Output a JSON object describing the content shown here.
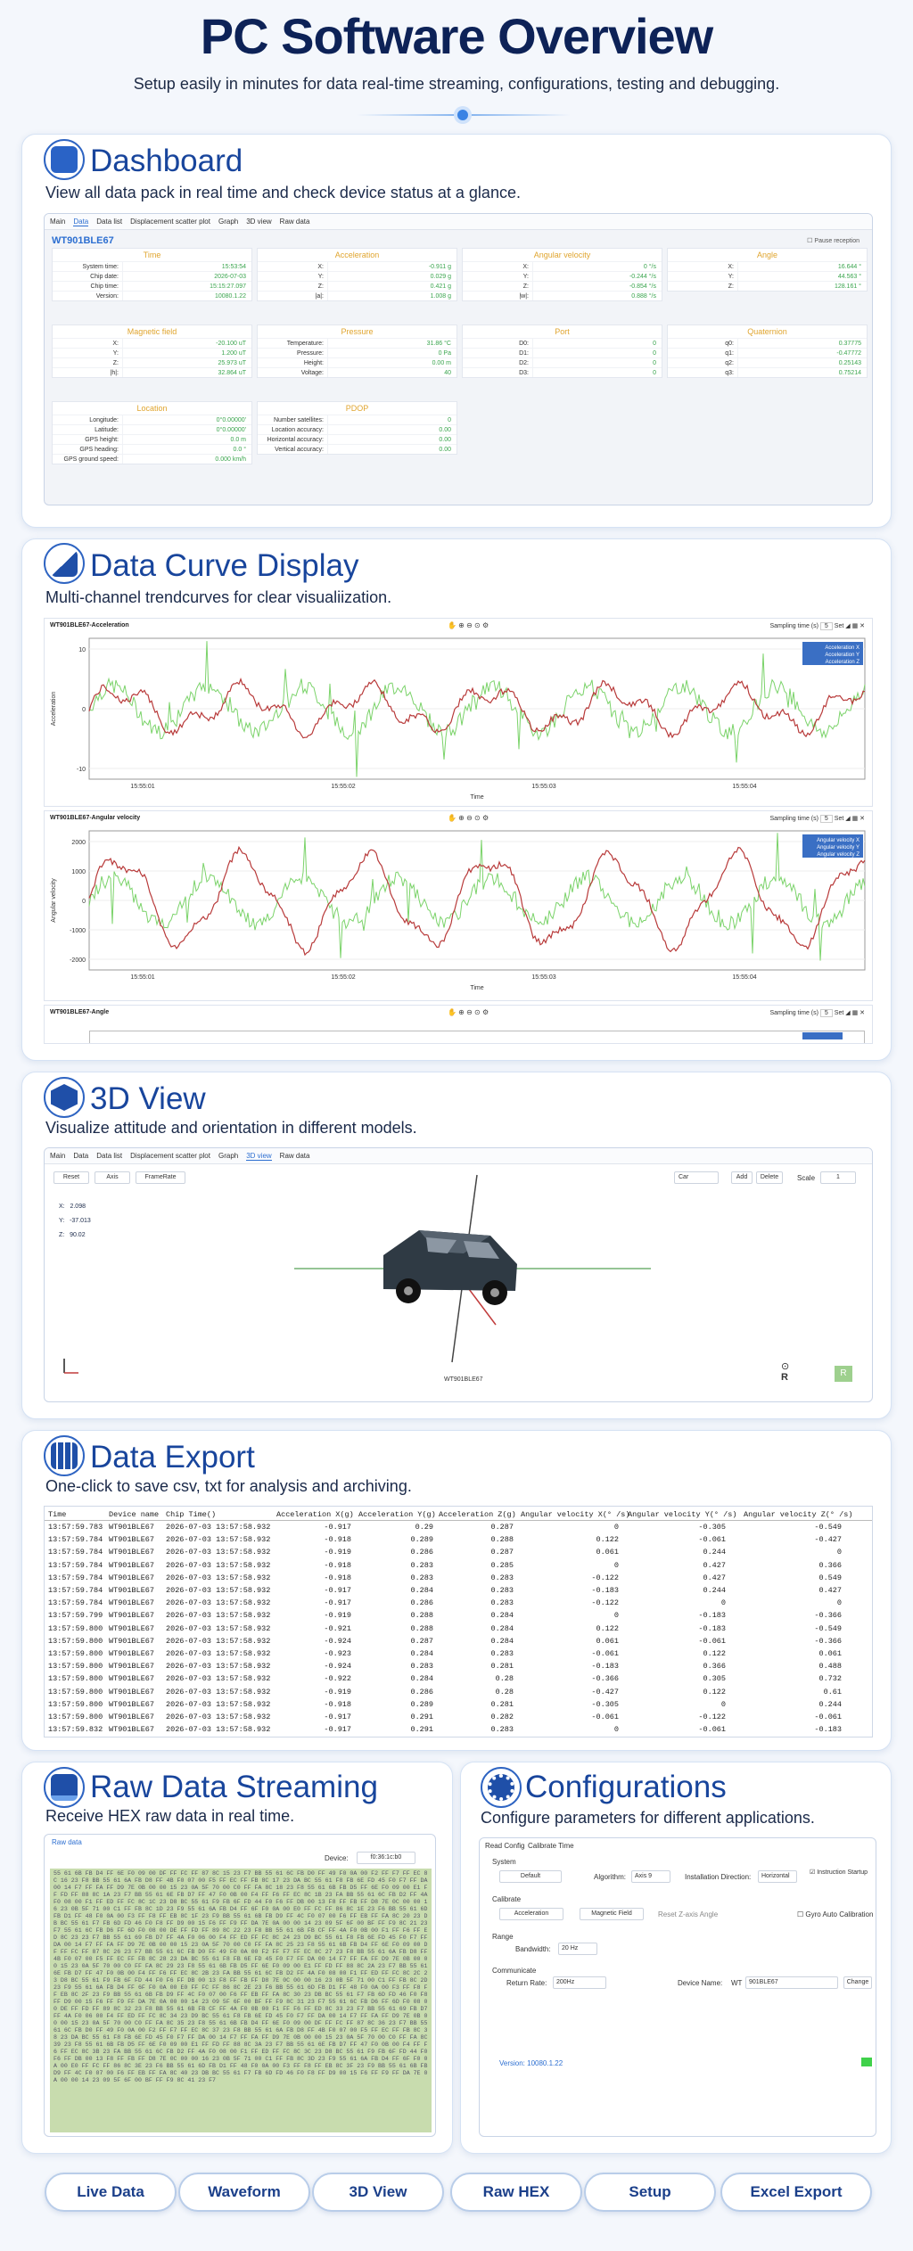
{
  "hero": {
    "title": "PC Software Overview",
    "subtitle": "Setup easily in minutes for data real-time streaming, configurations, testing and debugging."
  },
  "colors": {
    "accent": "#18459c",
    "series_red": "#b83a3a",
    "series_green": "#7bd36a",
    "green_value": "#3aa54e",
    "label_orange": "#e0a52f"
  },
  "dashboard": {
    "title": "Dashboard",
    "subtitle": "View all data pack in real time and check device status at a glance.",
    "tabs": [
      "Main",
      "Data",
      "Data list",
      "Displacement scatter plot",
      "Graph",
      "3D view",
      "Raw data"
    ],
    "active_tab": "Data",
    "device": "WT901BLE67",
    "pause": "Pause reception",
    "blocks": [
      {
        "title": "Time",
        "rows": [
          [
            "System time:",
            "15:53:54"
          ],
          [
            "Chip date:",
            "2026-07-03"
          ],
          [
            "Chip time:",
            "15:15:27.097"
          ],
          [
            "Version:",
            "10080.1.22"
          ]
        ]
      },
      {
        "title": "Acceleration",
        "rows": [
          [
            "X:",
            "-0.911 g"
          ],
          [
            "Y:",
            "0.029 g"
          ],
          [
            "Z:",
            "0.421 g"
          ],
          [
            "|a|:",
            "1.008 g"
          ]
        ]
      },
      {
        "title": "Angular velocity",
        "rows": [
          [
            "X:",
            "0 °/s"
          ],
          [
            "Y:",
            "-0.244 °/s"
          ],
          [
            "Z:",
            "-0.854 °/s"
          ],
          [
            "|w|:",
            "0.888 °/s"
          ]
        ]
      },
      {
        "title": "Angle",
        "rows": [
          [
            "X:",
            "16.644 °"
          ],
          [
            "Y:",
            "44.563 °"
          ],
          [
            "Z:",
            "128.161 °"
          ]
        ]
      },
      {
        "title": "Magnetic field",
        "rows": [
          [
            "X:",
            "-20.100 uT"
          ],
          [
            "Y:",
            "1.200 uT"
          ],
          [
            "Z:",
            "25.973 uT"
          ],
          [
            "|h|:",
            "32.864 uT"
          ]
        ]
      },
      {
        "title": "Pressure",
        "rows": [
          [
            "Temperature:",
            "31.86 °C"
          ],
          [
            "Pressure:",
            "0 Pa"
          ],
          [
            "Height:",
            "0.00 m"
          ],
          [
            "Voltage:",
            "40"
          ]
        ]
      },
      {
        "title": "Port",
        "rows": [
          [
            "D0:",
            "0"
          ],
          [
            "D1:",
            "0"
          ],
          [
            "D2:",
            "0"
          ],
          [
            "D3:",
            "0"
          ]
        ]
      },
      {
        "title": "Quaternion",
        "rows": [
          [
            "q0:",
            "0.37775"
          ],
          [
            "q1:",
            "-0.47772"
          ],
          [
            "q2:",
            "0.25143"
          ],
          [
            "q3:",
            "0.75214"
          ]
        ]
      },
      {
        "title": "Location",
        "rows": [
          [
            "Longitude:",
            "0°0.00000'"
          ],
          [
            "Latitude:",
            "0°0.00000'"
          ],
          [
            "GPS height:",
            "0.0 m"
          ],
          [
            "GPS heading:",
            "0.0 °"
          ],
          [
            "GPS ground speed:",
            "0.000 km/h"
          ]
        ]
      },
      {
        "title": "PDOP",
        "rows": [
          [
            "Number satellites:",
            "0"
          ],
          [
            "Location accuracy:",
            "0.00"
          ],
          [
            "Horizontal accuracy:",
            "0.00"
          ],
          [
            "Vertical accuracy:",
            "0.00"
          ]
        ]
      }
    ]
  },
  "curves": {
    "title": "Data Curve Display",
    "subtitle": "Multi-channel trendcurves for clear visualiization.",
    "sampling": "Sampling time (s)",
    "sampling_val": "5",
    "set": "Set",
    "plot1": {
      "title": "WT901BLE67-Acceleration",
      "ylabel": "Acceleration",
      "xlabel": "Time",
      "yticks": [
        "10",
        "0",
        "-10"
      ],
      "xticks": [
        "15:55:01",
        "15:55:02",
        "15:55:03",
        "15:55:04"
      ],
      "legend": [
        "Acceleration X",
        "Acceleration Y",
        "Acceleration Z"
      ]
    },
    "plot2": {
      "title": "WT901BLE67-Angular velocity",
      "ylabel": "Angular velocity",
      "xlabel": "Time",
      "yticks": [
        "2000",
        "1000",
        "0",
        "-1000",
        "-2000"
      ],
      "xticks": [
        "15:55:01",
        "15:55:02",
        "15:55:03",
        "15:55:04"
      ],
      "legend": [
        "Angular velocity X",
        "Angular velocity Y",
        "Angular velocity Z"
      ]
    },
    "plot3": {
      "title": "WT901BLE67-Angle"
    }
  },
  "view3d": {
    "title": "3D View",
    "subtitle": "Visualize attitude and orientation in different models.",
    "buttons": [
      "Reset",
      "Axis",
      "FrameRate"
    ],
    "model": "Car",
    "add": "Add",
    "delete": "Delete",
    "scale_label": "Scale",
    "scale_val": "1",
    "coords": [
      [
        "X:",
        "2.098"
      ],
      [
        "Y:",
        "-37.013"
      ],
      [
        "Z:",
        "90.02"
      ]
    ],
    "device": "WT901BLE67",
    "r_label": "R"
  },
  "export": {
    "title": "Data Export",
    "subtitle": "One-click to save csv, txt for analysis and archiving.",
    "columns": [
      "Time",
      "Device name",
      "Chip Time()",
      "Acceleration X(g)",
      "Acceleration Y(g)",
      "Acceleration Z(g)",
      "Angular velocity X(° /s)",
      "Angular velocity Y(° /s)",
      "Angular velocity Z(° /s)"
    ],
    "rows": [
      [
        "13:57:59.783",
        "WT901BLE67",
        "2026-07-03 13:57:58.932",
        "-0.917",
        "0.29",
        "0.287",
        "0",
        "-0.305",
        "-0.549"
      ],
      [
        "13:57:59.784",
        "WT901BLE67",
        "2026-07-03 13:57:58.932",
        "-0.918",
        "0.289",
        "0.288",
        "0.122",
        "-0.061",
        "-0.427"
      ],
      [
        "13:57:59.784",
        "WT901BLE67",
        "2026-07-03 13:57:58.932",
        "-0.919",
        "0.286",
        "0.287",
        "0.061",
        "0.244",
        "0"
      ],
      [
        "13:57:59.784",
        "WT901BLE67",
        "2026-07-03 13:57:58.932",
        "-0.918",
        "0.283",
        "0.285",
        "0",
        "0.427",
        "0.366"
      ],
      [
        "13:57:59.784",
        "WT901BLE67",
        "2026-07-03 13:57:58.932",
        "-0.918",
        "0.283",
        "0.283",
        "-0.122",
        "0.427",
        "0.549"
      ],
      [
        "13:57:59.784",
        "WT901BLE67",
        "2026-07-03 13:57:58.932",
        "-0.917",
        "0.284",
        "0.283",
        "-0.183",
        "0.244",
        "0.427"
      ],
      [
        "13:57:59.784",
        "WT901BLE67",
        "2026-07-03 13:57:58.932",
        "-0.917",
        "0.286",
        "0.283",
        "-0.122",
        "0",
        "0"
      ],
      [
        "13:57:59.799",
        "WT901BLE67",
        "2026-07-03 13:57:58.932",
        "-0.919",
        "0.288",
        "0.284",
        "0",
        "-0.183",
        "-0.366"
      ],
      [
        "13:57:59.800",
        "WT901BLE67",
        "2026-07-03 13:57:58.932",
        "-0.921",
        "0.288",
        "0.284",
        "0.122",
        "-0.183",
        "-0.549"
      ],
      [
        "13:57:59.800",
        "WT901BLE67",
        "2026-07-03 13:57:58.932",
        "-0.924",
        "0.287",
        "0.284",
        "0.061",
        "-0.061",
        "-0.366"
      ],
      [
        "13:57:59.800",
        "WT901BLE67",
        "2026-07-03 13:57:58.932",
        "-0.923",
        "0.284",
        "0.283",
        "-0.061",
        "0.122",
        "0.061"
      ],
      [
        "13:57:59.800",
        "WT901BLE67",
        "2026-07-03 13:57:58.932",
        "-0.924",
        "0.283",
        "0.281",
        "-0.183",
        "0.366",
        "0.488"
      ],
      [
        "13:57:59.800",
        "WT901BLE67",
        "2026-07-03 13:57:58.932",
        "-0.922",
        "0.284",
        "0.28",
        "-0.366",
        "0.305",
        "0.732"
      ],
      [
        "13:57:59.800",
        "WT901BLE67",
        "2026-07-03 13:57:58.932",
        "-0.919",
        "0.286",
        "0.28",
        "-0.427",
        "0.122",
        "0.61"
      ],
      [
        "13:57:59.800",
        "WT901BLE67",
        "2026-07-03 13:57:58.932",
        "-0.918",
        "0.289",
        "0.281",
        "-0.305",
        "0",
        "0.244"
      ],
      [
        "13:57:59.800",
        "WT901BLE67",
        "2026-07-03 13:57:58.932",
        "-0.917",
        "0.291",
        "0.282",
        "-0.061",
        "-0.122",
        "-0.061"
      ],
      [
        "13:57:59.832",
        "WT901BLE67",
        "2026-07-03 13:57:58.932",
        "-0.917",
        "0.291",
        "0.283",
        "0",
        "-0.061",
        "-0.183"
      ]
    ]
  },
  "raw": {
    "title": "Raw Data Streaming",
    "subtitle": "Receive HEX raw data in real time.",
    "tab": "Raw data",
    "device_label": "Device:",
    "device_val": "f0:36:1c:b0",
    "hex": "55 61 6B FB D4 FF 6E F0 09 00 DF FF FC FF 87 8C 15 23 F7 BB 55 61 6C FB D0 FF 49 F0 0A 00 F2 FF F7 FF EC 8C 16 23 F8 BB 55 61 6A FB D8 FF 4B F0 07 00 F5 FF EC FF FB 8C 17 23 DA BC 55 61 F8 FB 6E FD 45 F0 F7 FF DA 00 14 F7 FF FA FF D9 7E 0B 00 00 15 23 0A 5F 70 00 C0 FF FA 8C 18 23 F8 55 61 6B FB D5 FF 6E F0 09 00 E1 FF FD FF 88 8C 1A 23 F7 BB 55 61 6E FB D7 FF 47 F0 0B 00 F4 FF F6 FF EC 8C 1B 23 FA BB 55 61 6C FB D2 FF 4A F0 08 00 F1 FF ED FF FC 8C 1C 23 D8 BC 55 61 F9 FB 6F FD 44 F0 F6 FF DB 00 13 F8 FF FB FF D8 7E 0C 00 00 16 23 0B 5F 71 00 C1 FF FB 8C 1D 23 F9 55 61 6A FB D4 FF 6F F0 0A 00 E0 FF FC FF 86 8C 1E 23 F6 BB 55 61 6D FB D1 FF 48 F0 0A 00 F3 FF F8 FF EB 8C 1F 23 F9 BB 55 61 6B FB D9 FF 4C F0 07 00 F6 FF EB FF FA 8C 20 23 DB BC 55 61 F7 FB 6D FD 46 F0 F8 FF D9 00 15 F6 FF F9 FF DA 7E 0A 00 00 14 23 09 5F 6F 00 BF FF F9 8C 21 23 F7 55 61 6C FB D6 FF 6D F0 08 00 DE FF FD FF 89 8C 22 23 F8 BB 55 61 6B FB CF FF 4A F0 0B 00 F1 FF F6 FF ED 8C 23 23 F7 BB 55 61 69 FB D7 FF 4A F0 06 00 F4 FF ED FF FC 8C 24 23 D9 BC 55 61 F8 FB 6E FD 45 F0 F7 FF DA 00 14 F7 FF FA FF D9 7E 0B 00 00 15 23 0A 5F 70 00 C0 FF FA 8C 25 23 F8 55 61 6B FB D4 FF 6E F0 09 00 DF FF FC FF 87 8C 26 23 F7 BB 55 61 6C FB D0 FF 49 F0 0A 00 F2 FF F7 FF EC 8C 27 23 F8 BB 55 61 6A FB D8 FF 4B F0 07 00 F5 FF EC FF FB 8C 28 23 DA BC 55 61 F8 FB 6E FD 45 F0 F7 FF DA 00 14 F7 FF FA FF D9 7E 0B 00 00 15 23 0A 5F 70 00 C0 FF FA 8C 29 23 F8 55 61 6B FB D5 FF 6E F0 09 00 E1 FF FD FF 88 8C 2A 23 F7 BB 55 61 6E FB D7 FF 47 F0 0B 00 F4 FF F6 FF EC 8C 2B 23 FA BB 55 61 6C FB D2 FF 4A F0 08 00 F1 FF ED FF FC 8C 2C 23 D8 BC 55 61 F9 FB 6F FD 44 F0 F6 FF DB 00 13 F8 FF FB FF D8 7E 0C 00 00 16 23 0B 5F 71 00 C1 FF FB 8C 2D 23 F9 55 61 6A FB D4 FF 6F F0 0A 00 E0 FF FC FF 86 8C 2E 23 F6 BB 55 61 6D FB D1 FF 48 F0 0A 00 F3 FF F8 FF EB 8C 2F 23 F9 BB 55 61 6B FB D9 FF 4C F0 07 00 F6 FF EB FF FA 8C 30 23 DB BC 55 61 F7 FB 6D FD 46 F0 F8 FF D9 00 15 F6 FF F9 FF DA 7E 0A 00 00 14 23 09 5F 6F 00 BF FF F9 8C 31 23 F7 55 61 6C FB D6 FF 6D F0 08 00 DE FF FD FF 89 8C 32 23 F8 BB 55 61 6B FB CF FF 4A F0 0B 00 F1 FF F6 FF ED 8C 33 23 F7 BB 55 61 69 FB D7 FF 4A F0 06 00 F4 FF ED FF FC 8C 34 23 D9 BC 55 61 F8 FB 6E FD 45 F0 F7 FF DA 00 14 F7 FF FA FF D9 7E 0B 00 00 15 23 0A 5F 70 00 C0 FF FA 8C 35 23 F8 55 61 6B FB D4 FF 6E F0 09 00 DF FF FC FF 87 8C 36 23 F7 BB 55 61 6C FB D0 FF 49 F0 0A 00 F2 FF F7 FF EC 8C 37 23 F8 BB 55 61 6A FB D8 FF 4B F0 07 00 F5 FF EC FF FB 8C 38 23 DA BC 55 61 F8 FB 6E FD 45 F0 F7 FF DA 00 14 F7 FF FA FF D9 7E 0B 00 00 15 23 0A 5F 70 00 C0 FF FA 8C 39 23 F8 55 61 6B FB D5 FF 6E F0 09 00 E1 FF FD FF 88 8C 3A 23 F7 BB 55 61 6E FB D7 FF 47 F0 0B 00 F4 FF F6 FF EC 8C 3B 23 FA BB 55 61 6C FB D2 FF 4A F0 08 00 F1 FF ED FF FC 8C 3C 23 D8 BC 55 61 F9 FB 6F FD 44 F0 F6 FF DB 00 13 F8 FF FB FF D8 7E 0C 00 00 16 23 0B 5F 71 00 C1 FF FB 8C 3D 23 F9 55 61 6A FB D4 FF 6F F0 0A 00 E0 FF FC FF 86 8C 3E 23 F6 BB 55 61 6D FB D1 FF 48 F0 0A 00 F3 FF F8 FF EB 8C 3F 23 F9 BB 55 61 6B FB D9 FF 4C F0 07 00 F6 FF EB FF FA 8C 40 23 DB BC 55 61 F7 FB 6D FD 46 F0 F8 FF D9 00 15 F6 FF F9 FF DA 7E 0A 00 00 14 23 09 5F 6F 00 BF FF F9 8C 41 23 F7"
  },
  "config": {
    "title": "Configurations",
    "subtitle": "Configure parameters for different applications.",
    "tabs": [
      "Read Config",
      "Calibrate Time"
    ],
    "system": "System",
    "default_btn": "Default",
    "algorithm_label": "Algorithm:",
    "algorithm_val": "Axis 9",
    "install_label": "Installation Direction:",
    "install_val": "Horizontal",
    "instruction": "Instruction Startup",
    "calibrate": "Calibrate",
    "accel_btn": "Acceleration",
    "mag_btn": "Magnetic Field",
    "reset_z": "Reset Z-axis Angle",
    "gyro_auto": "Gyro Auto Calibration",
    "range": "Range",
    "bandwidth_label": "Bandwidth:",
    "bandwidth_val": "20 Hz",
    "communicate": "Communicate",
    "return_label": "Return Rate:",
    "return_val": "200Hz",
    "devname_label": "Device Name:",
    "devname_prefix": "WT",
    "devname_val": "901BLE67",
    "change_btn": "Change",
    "version": "Version: 10080.1.22"
  },
  "nav": [
    "Live Data",
    "Waveform",
    "3D View",
    "Raw HEX",
    "Setup",
    "Excel Export"
  ]
}
